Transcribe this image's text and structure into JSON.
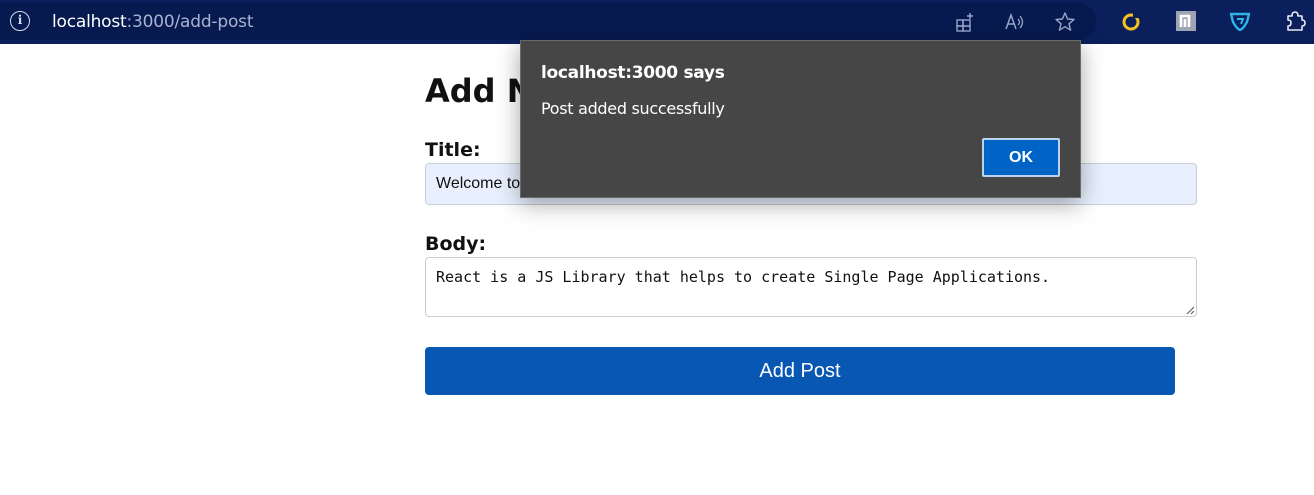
{
  "browser": {
    "url_host": "localhost",
    "url_path": ":3000/add-post",
    "icons": [
      "info-icon",
      "app-available-icon",
      "read-aloud-icon",
      "favorite-star-icon",
      "extension-ring-icon",
      "extension-n-icon",
      "extension-shield-icon",
      "extensions-puzzle-icon"
    ]
  },
  "page": {
    "heading": "Add New Post",
    "title_label": "Title:",
    "title_value": "Welcome to React",
    "body_label": "Body:",
    "body_value": "React is a JS Library that helps to create Single Page Applications.",
    "submit_label": "Add Post"
  },
  "dialog": {
    "title": "localhost:3000 says",
    "message": "Post added successfully",
    "ok_label": "OK"
  },
  "colors": {
    "toolbar": "#0a1f5c",
    "primary_button": "#0857b3",
    "dialog_bg": "#464646",
    "dialog_ok": "#0063c6",
    "autofill_bg": "#e8f0fe"
  }
}
